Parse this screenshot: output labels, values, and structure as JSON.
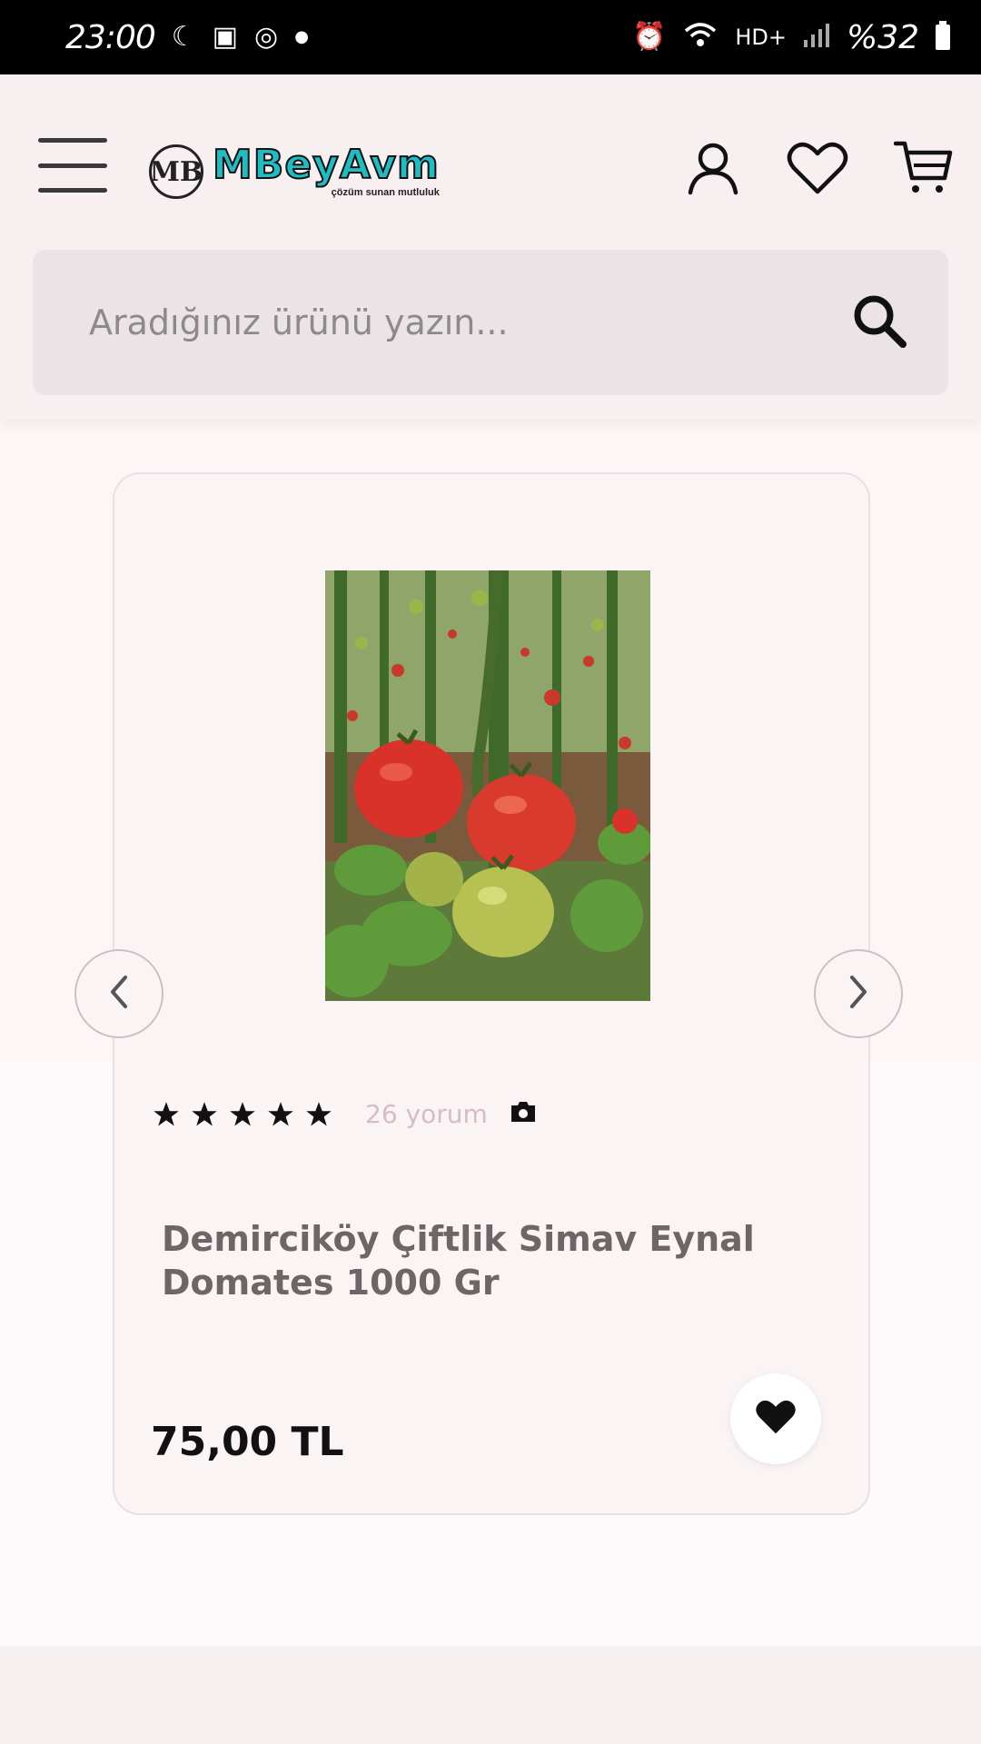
{
  "status_bar": {
    "time": "23:00",
    "left_icons": [
      "moon-icon",
      "gallery-icon",
      "instagram-icon",
      "dot-icon"
    ],
    "right_icons": [
      "alarm-icon",
      "wifi-icon",
      "hd-plus-icon",
      "signal-icon"
    ],
    "battery": "%32"
  },
  "header": {
    "logo_mark": "MB",
    "logo_text": "MBeyAvm",
    "logo_tagline": "çözüm sunan mutluluk",
    "icons": [
      "menu-icon",
      "user-icon",
      "heart-icon",
      "cart-icon"
    ]
  },
  "search": {
    "placeholder": "Aradığınız ürünü yazın..."
  },
  "product": {
    "image": "tomato-plant-photo",
    "rating": 5,
    "review_count": "26 yorum",
    "title": "Demirciköy Çiftlik Simav Eynal Domates 1000 Gr",
    "price": "75,00 TL"
  },
  "colors": {
    "accent": "#1fbcc4",
    "background": "#fdf6f7",
    "title_text": "#6f6466",
    "review_text": "#d7bcc6"
  }
}
